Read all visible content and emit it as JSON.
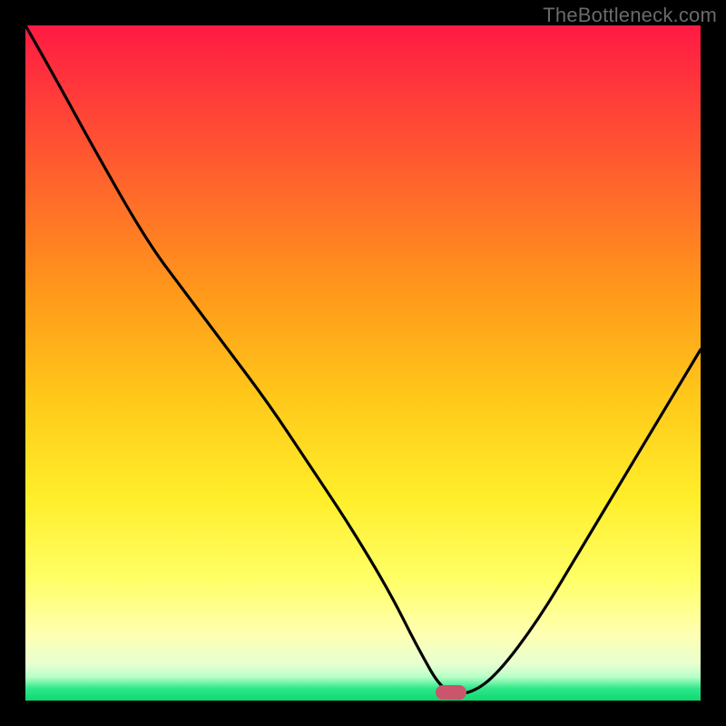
{
  "attribution": "TheBottleneck.com",
  "marker": {
    "x_pct": 63,
    "y_pct": 98.8
  },
  "chart_data": {
    "type": "line",
    "title": "",
    "xlabel": "",
    "ylabel": "",
    "xlim": [
      0,
      100
    ],
    "ylim": [
      0,
      100
    ],
    "series": [
      {
        "name": "bottleneck-curve",
        "x": [
          0,
          4,
          10,
          18,
          24,
          30,
          36,
          42,
          48,
          54,
          58,
          62,
          66,
          70,
          76,
          82,
          88,
          94,
          100
        ],
        "values": [
          100,
          93,
          82,
          68,
          60,
          52,
          44,
          35,
          26,
          16,
          8,
          1,
          1,
          4,
          12,
          22,
          32,
          42,
          52
        ]
      }
    ],
    "annotations": [
      {
        "type": "marker",
        "x": 63,
        "y": 1.2,
        "label": "optimal-point"
      }
    ]
  }
}
